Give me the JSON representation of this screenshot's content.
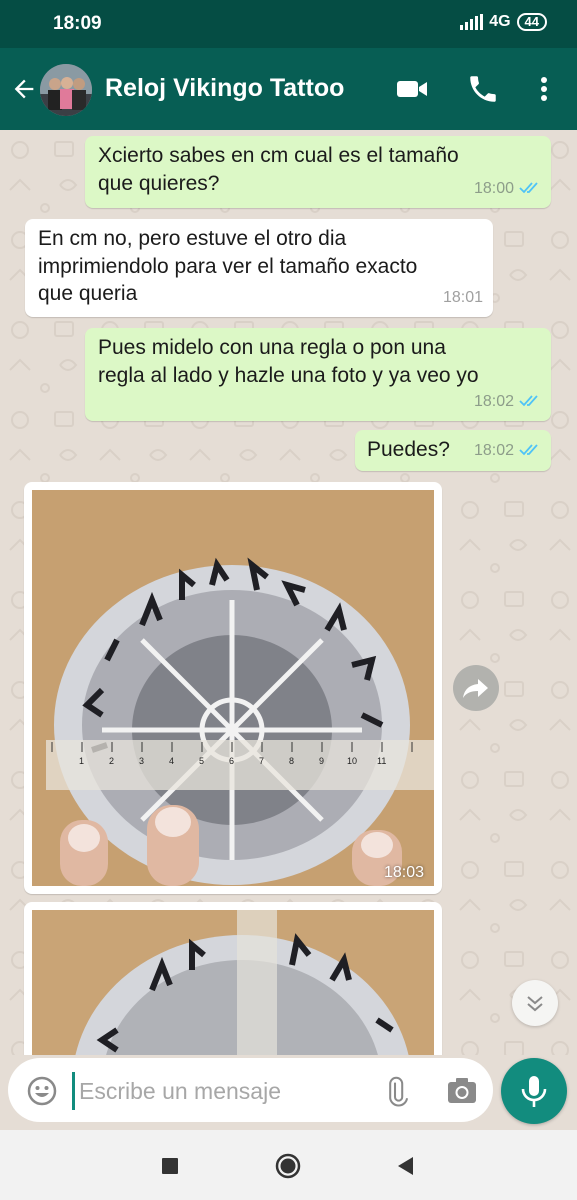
{
  "status_bar": {
    "time": "18:09",
    "network": "4G",
    "battery": "44"
  },
  "header": {
    "title": "Reloj Vikingo Tattoo"
  },
  "messages": [
    {
      "dir": "out",
      "lines": [
        "Xcierto sabes en cm cual es el tamaño",
        "que quieres?"
      ],
      "time": "18:00"
    },
    {
      "dir": "in",
      "lines": [
        "En cm no, pero estuve el otro dia",
        "imprimiendolo para ver el tamaño exacto",
        "que queria"
      ],
      "time": "18:01"
    },
    {
      "dir": "out",
      "lines": [
        "Pues midelo con una regla  o pon una",
        "regla al lado y hazle una foto y ya veo yo"
      ],
      "time": "18:02"
    },
    {
      "dir": "out",
      "lines": [
        "Puedes?"
      ],
      "time": "18:02"
    }
  ],
  "images": [
    {
      "time": "18:03",
      "ruler_numbers": [
        "1",
        "2",
        "3",
        "4",
        "5",
        "6",
        "7",
        "8",
        "9",
        "10",
        "11"
      ]
    },
    {
      "time": ""
    }
  ],
  "composer": {
    "placeholder": "Escribe un mensaje"
  },
  "colors": {
    "header": "#075e54",
    "status_bar": "#054d44",
    "outgoing": "#dcf8c6",
    "accent": "#128c7e",
    "read_ticks": "#4fc3f7"
  }
}
